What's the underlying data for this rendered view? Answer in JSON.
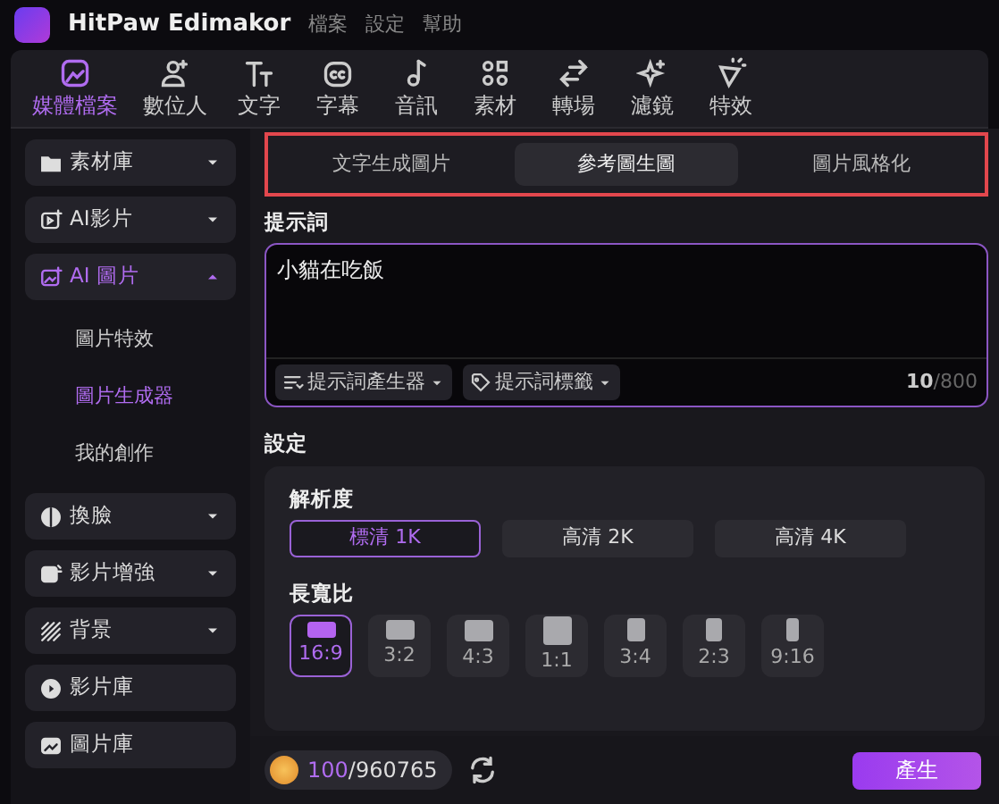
{
  "window": {
    "title": "HitPaw Edimakor",
    "menu": [
      "檔案",
      "設定",
      "幫助"
    ]
  },
  "toolbar": [
    {
      "label": "媒體檔案",
      "selected": true
    },
    {
      "label": "數位人",
      "selected": false
    },
    {
      "label": "文字",
      "selected": false
    },
    {
      "label": "字幕",
      "selected": false
    },
    {
      "label": "音訊",
      "selected": false
    },
    {
      "label": "素材",
      "selected": false
    },
    {
      "label": "轉場",
      "selected": false
    },
    {
      "label": "濾鏡",
      "selected": false
    },
    {
      "label": "特效",
      "selected": false
    }
  ],
  "sidebar": {
    "items": [
      {
        "label": "素材庫",
        "expanded": false,
        "selected": false
      },
      {
        "label": "AI影片",
        "expanded": false,
        "selected": false
      },
      {
        "label": "AI 圖片",
        "expanded": true,
        "selected": true,
        "children": [
          {
            "label": "圖片特效",
            "selected": false
          },
          {
            "label": "圖片生成器",
            "selected": true
          },
          {
            "label": "我的創作",
            "selected": false
          }
        ]
      },
      {
        "label": "換臉",
        "expanded": false,
        "selected": false
      },
      {
        "label": "影片增強",
        "expanded": false,
        "selected": false
      },
      {
        "label": "背景",
        "expanded": false,
        "selected": false
      },
      {
        "label": "影片庫",
        "selected": false
      },
      {
        "label": "圖片庫",
        "selected": false
      }
    ]
  },
  "mode_tabs": [
    {
      "label": "文字生成圖片",
      "selected": false
    },
    {
      "label": "參考圖生圖",
      "selected": true
    },
    {
      "label": "圖片風格化",
      "selected": false
    }
  ],
  "prompt": {
    "label": "提示詞",
    "value": "小貓在吃飯",
    "buttons": [
      "提示詞產生器",
      "提示詞標籤"
    ],
    "count": "10",
    "max": "/800"
  },
  "settings": {
    "label": "設定",
    "resolution": {
      "label": "解析度",
      "options": [
        {
          "label": "標清 1K",
          "selected": true
        },
        {
          "label": "高清 2K",
          "selected": false
        },
        {
          "label": "高清 4K",
          "selected": false
        }
      ]
    },
    "aspect": {
      "label": "長寬比",
      "options": [
        {
          "label": "16:9",
          "selected": true
        },
        {
          "label": "3:2",
          "selected": false
        },
        {
          "label": "4:3",
          "selected": false
        },
        {
          "label": "1:1",
          "selected": false
        },
        {
          "label": "3:4",
          "selected": false
        },
        {
          "label": "2:3",
          "selected": false
        },
        {
          "label": "9:16",
          "selected": false
        }
      ]
    }
  },
  "footer": {
    "credits_used": "100",
    "credits_total": "/960765",
    "generate": "產生"
  }
}
